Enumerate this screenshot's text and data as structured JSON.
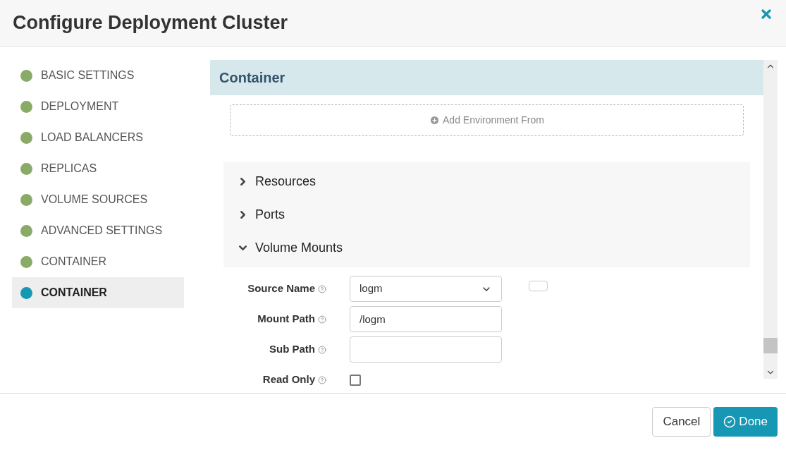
{
  "window": {
    "title": "Configure Deployment Cluster"
  },
  "steps": [
    {
      "label": "BASIC SETTINGS",
      "selected": false,
      "color": "#8aab67"
    },
    {
      "label": "DEPLOYMENT",
      "selected": false,
      "color": "#8aab67"
    },
    {
      "label": "LOAD BALANCERS",
      "selected": false,
      "color": "#8aab67"
    },
    {
      "label": "REPLICAS",
      "selected": false,
      "color": "#8aab67"
    },
    {
      "label": "VOLUME SOURCES",
      "selected": false,
      "color": "#8aab67"
    },
    {
      "label": "ADVANCED SETTINGS",
      "selected": false,
      "color": "#8aab67"
    },
    {
      "label": "CONTAINER",
      "selected": false,
      "color": "#8aab67"
    },
    {
      "label": "CONTAINER",
      "selected": true,
      "color": "#1698b4"
    }
  ],
  "section": {
    "title": "Container",
    "add_button": "Add Environment From"
  },
  "groups": [
    {
      "label": "Resources",
      "expanded": false
    },
    {
      "label": "Ports",
      "expanded": false
    },
    {
      "label": "Volume Mounts",
      "expanded": true
    }
  ],
  "fields": [
    {
      "kind": "select",
      "label": "Source Name",
      "value": "logm"
    },
    {
      "kind": "text",
      "label": "Mount Path",
      "value": "/logm"
    },
    {
      "kind": "text",
      "label": "Sub Path"
    },
    {
      "kind": "checkbox",
      "label": "Read Only",
      "checked": false
    }
  ],
  "buttons": {
    "cancel": "Cancel",
    "done": "Done"
  }
}
